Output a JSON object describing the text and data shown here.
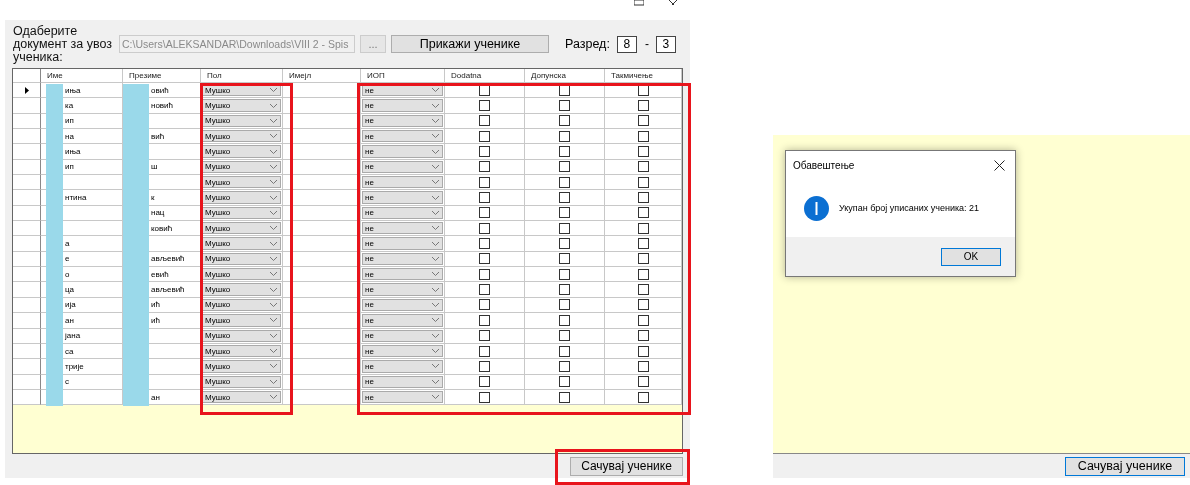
{
  "left_window": {
    "prompt": "Одаберите документ за увоз ученика:",
    "file_path": "C:\\Users\\ALEKSANDAR\\Downloads\\VIII 2 - Spis",
    "browse_button": "...",
    "show_button": "Прикажи ученике",
    "grade_label": "Разред:",
    "grade": "8",
    "separator": "-",
    "section": "3",
    "table": {
      "columns": [
        "Име",
        "Презиме",
        "Пол",
        "Имејл",
        "ИОП",
        "Dodatna",
        "Допунска",
        "Такмичење"
      ],
      "rows": [
        {
          "current": true,
          "first_name": "иња",
          "last_name": "овић",
          "gender": "Мушко",
          "iop": "не",
          "dodatna": false,
          "dopunska": false,
          "takmicenje": false
        },
        {
          "current": false,
          "first_name": "ка",
          "last_name": "новић",
          "gender": "Мушко",
          "iop": "не",
          "dodatna": false,
          "dopunska": false,
          "takmicenje": false
        },
        {
          "current": false,
          "first_name": "ип",
          "last_name": "",
          "gender": "Мушко",
          "iop": "не",
          "dodatna": false,
          "dopunska": false,
          "takmicenje": false
        },
        {
          "current": false,
          "first_name": "на",
          "last_name": "вић",
          "gender": "Мушко",
          "iop": "не",
          "dodatna": false,
          "dopunska": false,
          "takmicenje": false
        },
        {
          "current": false,
          "first_name": "иња",
          "last_name": "",
          "gender": "Мушко",
          "iop": "не",
          "dodatna": false,
          "dopunska": false,
          "takmicenje": false
        },
        {
          "current": false,
          "first_name": "ип",
          "last_name": "ш",
          "gender": "Мушко",
          "iop": "не",
          "dodatna": false,
          "dopunska": false,
          "takmicenje": false
        },
        {
          "current": false,
          "first_name": "",
          "last_name": "",
          "gender": "Мушко",
          "iop": "не",
          "dodatna": false,
          "dopunska": false,
          "takmicenje": false
        },
        {
          "current": false,
          "first_name": "нтина",
          "last_name": "к",
          "gender": "Мушко",
          "iop": "не",
          "dodatna": false,
          "dopunska": false,
          "takmicenje": false
        },
        {
          "current": false,
          "first_name": "",
          "last_name": "нац",
          "gender": "Мушко",
          "iop": "не",
          "dodatna": false,
          "dopunska": false,
          "takmicenje": false
        },
        {
          "current": false,
          "first_name": "",
          "last_name": "ковић",
          "gender": "Мушко",
          "iop": "не",
          "dodatna": false,
          "dopunska": false,
          "takmicenje": false
        },
        {
          "current": false,
          "first_name": "а",
          "last_name": "",
          "gender": "Мушко",
          "iop": "не",
          "dodatna": false,
          "dopunska": false,
          "takmicenje": false
        },
        {
          "current": false,
          "first_name": "е",
          "last_name": "ављевић",
          "gender": "Мушко",
          "iop": "не",
          "dodatna": false,
          "dopunska": false,
          "takmicenje": false
        },
        {
          "current": false,
          "first_name": "о",
          "last_name": "евић",
          "gender": "Мушко",
          "iop": "не",
          "dodatna": false,
          "dopunska": false,
          "takmicenje": false
        },
        {
          "current": false,
          "first_name": "ца",
          "last_name": "ављевић",
          "gender": "Мушко",
          "iop": "не",
          "dodatna": false,
          "dopunska": false,
          "takmicenje": false
        },
        {
          "current": false,
          "first_name": "ија",
          "last_name": "ић",
          "gender": "Мушко",
          "iop": "не",
          "dodatna": false,
          "dopunska": false,
          "takmicenje": false
        },
        {
          "current": false,
          "first_name": "ан",
          "last_name": "ић",
          "gender": "Мушко",
          "iop": "не",
          "dodatna": false,
          "dopunska": false,
          "takmicenje": false
        },
        {
          "current": false,
          "first_name": "јана",
          "last_name": "",
          "gender": "Мушко",
          "iop": "не",
          "dodatna": false,
          "dopunska": false,
          "takmicenje": false
        },
        {
          "current": false,
          "first_name": "са",
          "last_name": "",
          "gender": "Мушко",
          "iop": "не",
          "dodatna": false,
          "dopunska": false,
          "takmicenje": false
        },
        {
          "current": false,
          "first_name": "трије",
          "last_name": "",
          "gender": "Мушко",
          "iop": "не",
          "dodatna": false,
          "dopunska": false,
          "takmicenje": false
        },
        {
          "current": false,
          "first_name": "с",
          "last_name": "",
          "gender": "Мушко",
          "iop": "не",
          "dodatna": false,
          "dopunska": false,
          "takmicenje": false
        },
        {
          "current": false,
          "first_name": "",
          "last_name": "ан",
          "gender": "Мушко",
          "iop": "не",
          "dodatna": false,
          "dopunska": false,
          "takmicenje": false
        }
      ]
    },
    "save_button": "Сачувај ученике"
  },
  "right_window": {
    "dialog": {
      "title": "Обавештење",
      "message": "Укупан број уписаних ученика: 21",
      "ok_button": "OK"
    },
    "save_button": "Сачувај ученике"
  }
}
